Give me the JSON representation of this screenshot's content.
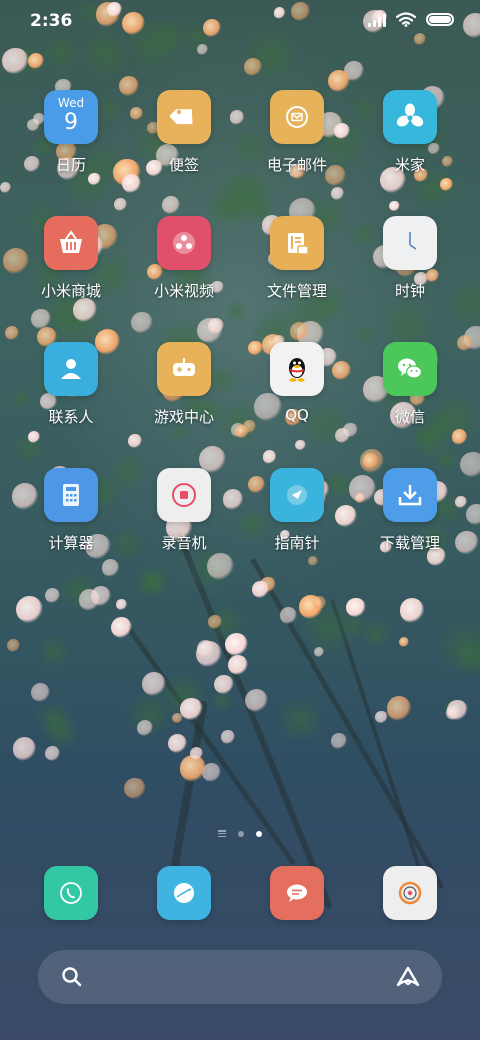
{
  "status_bar": {
    "time": "2:36"
  },
  "apps": [
    {
      "label": "日历",
      "icon": "calendar-icon",
      "color": "#4a9be8",
      "calendar_weekday": "Wed",
      "calendar_day": "9"
    },
    {
      "label": "便签",
      "icon": "notes-tag-icon",
      "color": "#e8b15c"
    },
    {
      "label": "电子邮件",
      "icon": "mail-icon",
      "color": "#e6b35a"
    },
    {
      "label": "米家",
      "icon": "mijia-fan-icon",
      "color": "#38b7dd"
    },
    {
      "label": "小米商城",
      "icon": "shopping-basket-icon",
      "color": "#e66d5e"
    },
    {
      "label": "小米视频",
      "icon": "video-play-icon",
      "color": "#e0506a"
    },
    {
      "label": "文件管理",
      "icon": "file-manager-icon",
      "color": "#e7b058"
    },
    {
      "label": "时钟",
      "icon": "clock-icon",
      "color": "#eef0f2"
    },
    {
      "label": "联系人",
      "icon": "contact-person-icon",
      "color": "#3aaedc"
    },
    {
      "label": "游戏中心",
      "icon": "gamepad-icon",
      "color": "#e7b25a"
    },
    {
      "label": "QQ",
      "icon": "qq-penguin-icon",
      "color": "#f2f2f2"
    },
    {
      "label": "微信",
      "icon": "wechat-icon",
      "color": "#4cc85b"
    },
    {
      "label": "计算器",
      "icon": "calculator-icon",
      "color": "#4d97e6"
    },
    {
      "label": "录音机",
      "icon": "recorder-icon",
      "color": "#eeeeee"
    },
    {
      "label": "指南针",
      "icon": "compass-icon",
      "color": "#3ab4dc"
    },
    {
      "label": "下载管理",
      "icon": "download-icon",
      "color": "#4d9de8"
    }
  ],
  "dock": [
    {
      "icon": "phone-icon",
      "color": "#33c7a4"
    },
    {
      "icon": "browser-icon",
      "color": "#3fb4e0"
    },
    {
      "icon": "messages-icon",
      "color": "#e46f5f"
    },
    {
      "icon": "music-icon",
      "color": "#eeeeee"
    }
  ],
  "page_indicator": {
    "pages": 3,
    "current": 3
  }
}
